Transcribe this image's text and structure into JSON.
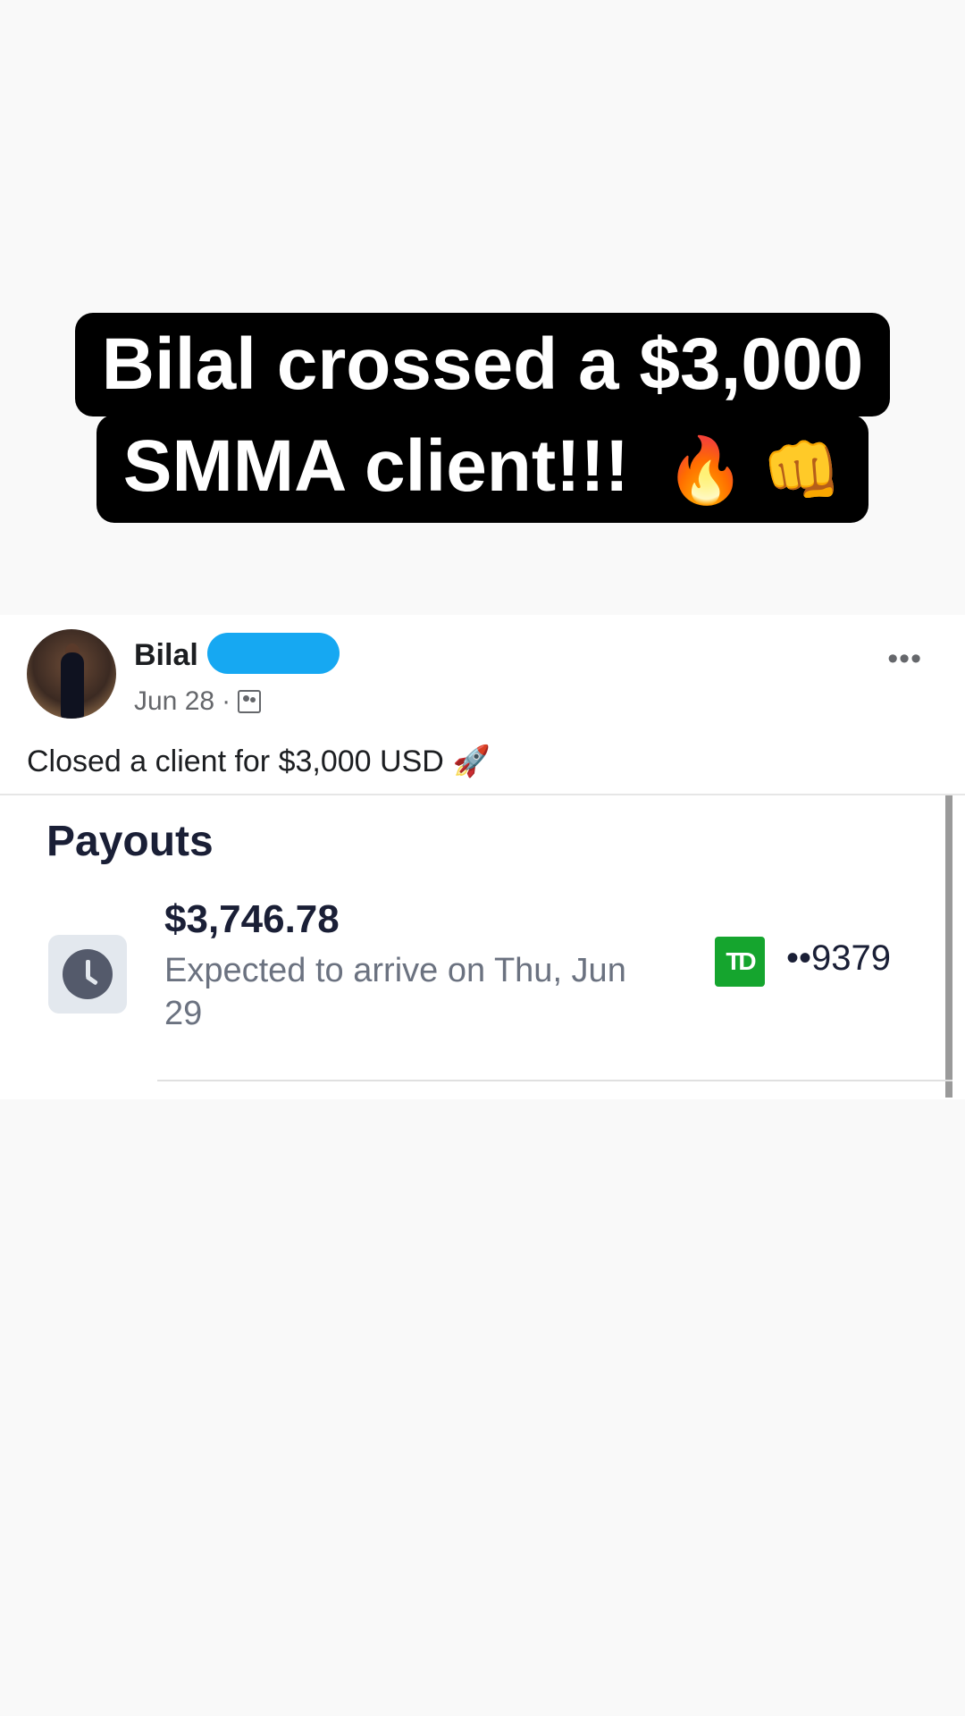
{
  "headline": {
    "line1": "Bilal crossed a $3,000",
    "line2": "SMMA client!!!",
    "emoji1": "🔥",
    "emoji2": "👊"
  },
  "post": {
    "author": "Bilal",
    "date": "Jun 28",
    "separator": "·",
    "audience_icon": "friends-icon",
    "more_icon": "•••",
    "text": "Closed a client for $3,000 USD",
    "text_emoji": "🚀"
  },
  "payouts": {
    "title": "Payouts",
    "items": [
      {
        "amount": "$3,746.78",
        "status": "Expected to arrive on Thu, Jun 29",
        "bank_logo": "TD",
        "account": "••9379",
        "icon": "clock-icon"
      }
    ]
  },
  "colors": {
    "headline_bg": "#000000",
    "redaction": "#16a8f2",
    "td_green": "#15a52e",
    "page_bg": "#f9f9f9"
  }
}
